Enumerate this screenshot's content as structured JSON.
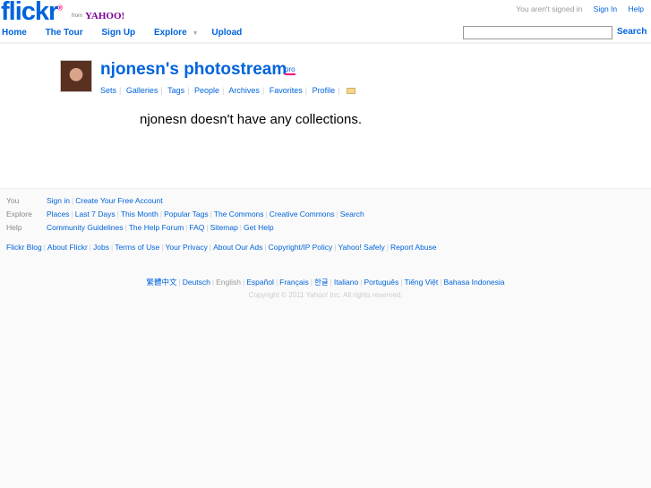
{
  "header": {
    "logo_main": "flickr",
    "logo_r": "®",
    "from": "from",
    "yahoo": "YAHOO!",
    "status": "You aren't signed in",
    "sign_in": "Sign In",
    "help": "Help",
    "nav": [
      "Home",
      "The Tour",
      "Sign Up",
      "Explore",
      "Upload"
    ],
    "search_value": "",
    "search_label": "Search"
  },
  "profile": {
    "title": "njonesn's photostream",
    "badge": "pro",
    "subnav": [
      "Sets",
      "Galleries",
      "Tags",
      "People",
      "Archives",
      "Favorites",
      "Profile"
    ]
  },
  "main": {
    "message": "njonesn doesn't have any collections."
  },
  "footer": {
    "rows": [
      {
        "label": "You",
        "links": [
          "Sign in",
          "Create Your Free Account"
        ]
      },
      {
        "label": "Explore",
        "links": [
          "Places",
          "Last 7 Days",
          "This Month",
          "Popular Tags",
          "The Commons",
          "Creative Commons",
          "Search"
        ]
      },
      {
        "label": "Help",
        "links": [
          "Community Guidelines",
          "The Help Forum",
          "FAQ",
          "Sitemap",
          "Get Help"
        ]
      }
    ],
    "misc": [
      "Flickr Blog",
      "About Flickr",
      "Jobs",
      "Terms of Use",
      "Your Privacy",
      "About Our Ads",
      "Copyright/IP Policy",
      "Yahoo! Safely",
      "Report Abuse"
    ],
    "languages": [
      "繁體中文",
      "Deutsch",
      "English",
      "Español",
      "Français",
      "한글",
      "Italiano",
      "Português",
      "Tiếng Việt",
      "Bahasa Indonesia"
    ],
    "current_language": "English",
    "copyright": "Copyright © 2011 Yahoo! Inc. All rights reserved."
  }
}
